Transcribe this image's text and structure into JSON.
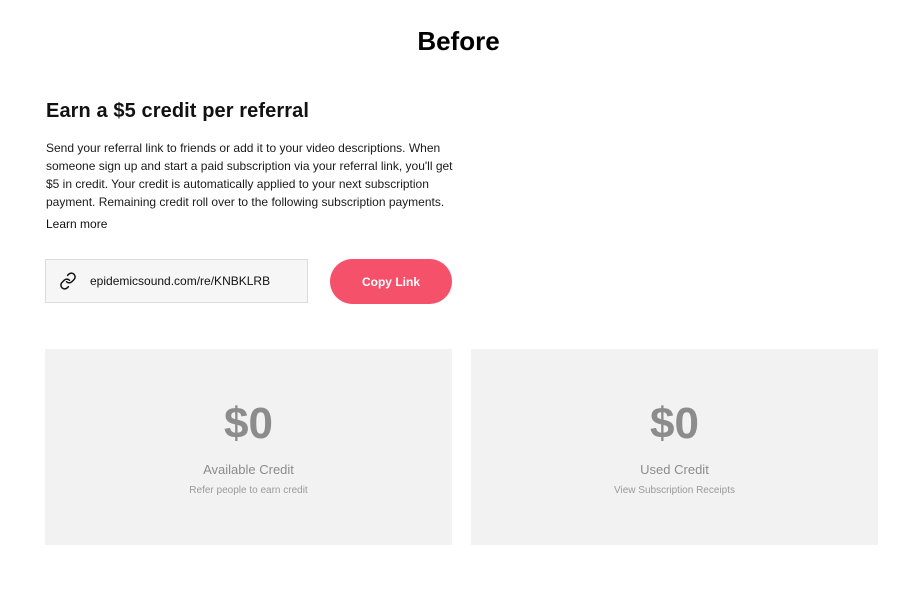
{
  "heading": "Before",
  "referral": {
    "title": "Earn a $5 credit per referral",
    "description": "Send your referral link to friends or add it to your video descriptions. When someone sign up and start a paid subscription via your referral link, you'll get $5 in credit. Your credit is automatically applied to your next subscription payment. Remaining credit roll over to the following subscription payments.",
    "learn_more": "Learn more",
    "link_value": "epidemicsound.com/re/KNBKLRB",
    "copy_button": "Copy Link",
    "link_icon": "link-icon"
  },
  "cards": {
    "available": {
      "amount": "$0",
      "label": "Available Credit",
      "sublabel": "Refer people to earn credit"
    },
    "used": {
      "amount": "$0",
      "label": "Used Credit",
      "sublabel": "View Subscription Receipts"
    }
  },
  "colors": {
    "accent": "#f5516a",
    "card_background": "#f2f2f2",
    "muted_text": "#8c8c8c"
  }
}
